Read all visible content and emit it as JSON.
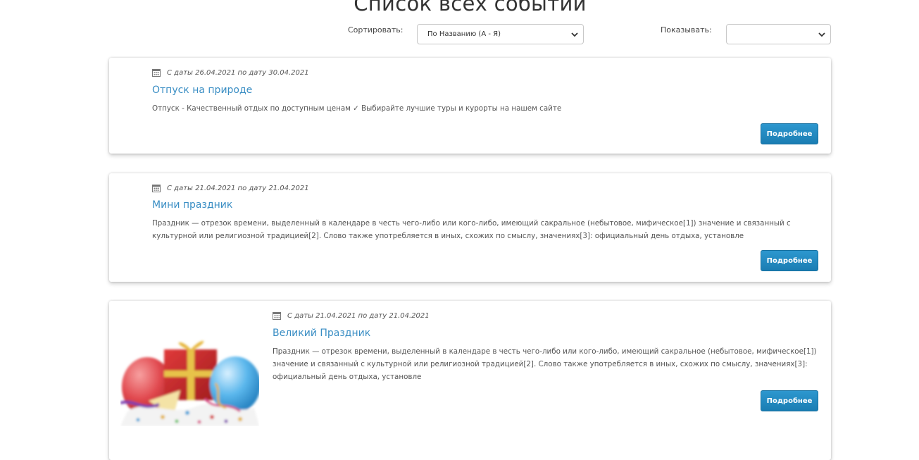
{
  "page": {
    "title": "Список всех событий"
  },
  "filters": {
    "sort_label": "Сортировать:",
    "sort_value": "По Названию (А - Я)",
    "show_label": "Показывать:",
    "show_value": ""
  },
  "events": [
    {
      "date": "С даты 26.04.2021 по дату 30.04.2021",
      "title": "Отпуск на природе",
      "description": "Отпуск - Качественный отдых по доступным ценам ✓ Выбирайте лучшие туры и курорты на нашем сайте",
      "button": "Подробнее"
    },
    {
      "date": "С даты 21.04.2021 по дату 21.04.2021",
      "title": "Мини праздник",
      "description": "Праздник — отрезок времени, выделенный в календаре в честь чего-либо или кого-либо, имеющий сакральное (небытовое, мифическое[1]) значение и связанный с культурной или религиозной традицией[2]. Слово также употребляется в иных, схожих по смыслу, значениях[3]: официальный день отдыха, установле",
      "button": "Подробнее"
    },
    {
      "date": "С даты 21.04.2021 по дату 21.04.2021",
      "title": "Великий Праздник",
      "description": "Праздник — отрезок времени, выделенный в календаре в честь чего-либо или кого-либо, имеющий сакральное (небытовое, мифическое[1]) значение и связанный с культурной или религиозной традицией[2]. Слово также употребляется в иных, схожих по смыслу, значениях[3]: официальный день отдыха, установле",
      "button": "Подробнее",
      "image": "balloons-gift-party-image"
    }
  ],
  "icons": {
    "calendar": "calendar-icon",
    "select_arrow": "chevron-down-icon"
  },
  "colors": {
    "link": "#3a8ec4",
    "button": "#2289c0",
    "text": "#555555"
  }
}
